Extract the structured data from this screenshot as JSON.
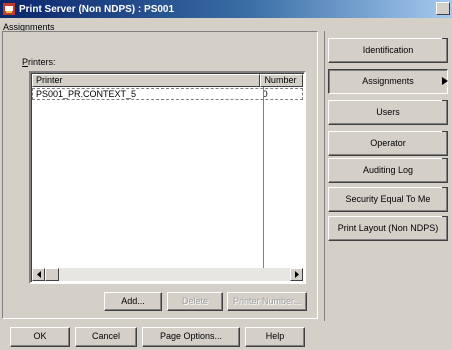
{
  "window": {
    "title": "Print Server (Non NDPS) : PS001"
  },
  "section": {
    "assignments_label": "Assignments"
  },
  "printers": {
    "label_mnemonic": "P",
    "label_rest": "rinters:",
    "columns": [
      "Printer",
      "Number"
    ],
    "rows": [
      {
        "printer": "PS001_PR.CONTEXT_5",
        "number": "0"
      }
    ]
  },
  "actions": {
    "add": "Add...",
    "delete": "Delete",
    "printer_number": "Printer Number..."
  },
  "footer": {
    "ok": "OK",
    "cancel": "Cancel",
    "page_options": "Page Options...",
    "help": "Help"
  },
  "tabs": [
    {
      "label": "Identification",
      "active": false
    },
    {
      "label": "Assignments",
      "active": true
    },
    {
      "label": "Users",
      "active": false
    },
    {
      "label": "Operator",
      "active": false
    },
    {
      "label": "Auditing Log",
      "active": false
    },
    {
      "label": "Security Equal To Me",
      "active": false
    },
    {
      "label": "Print Layout (Non NDPS)",
      "active": false
    }
  ],
  "colors": {
    "titlebar_start": "#0a246a",
    "titlebar_end": "#a6caf0",
    "face": "#d4d0c8"
  },
  "icons": {
    "app": "printer-server-icon",
    "scroll_left": "arrow-left-icon",
    "scroll_right": "arrow-right-icon"
  }
}
